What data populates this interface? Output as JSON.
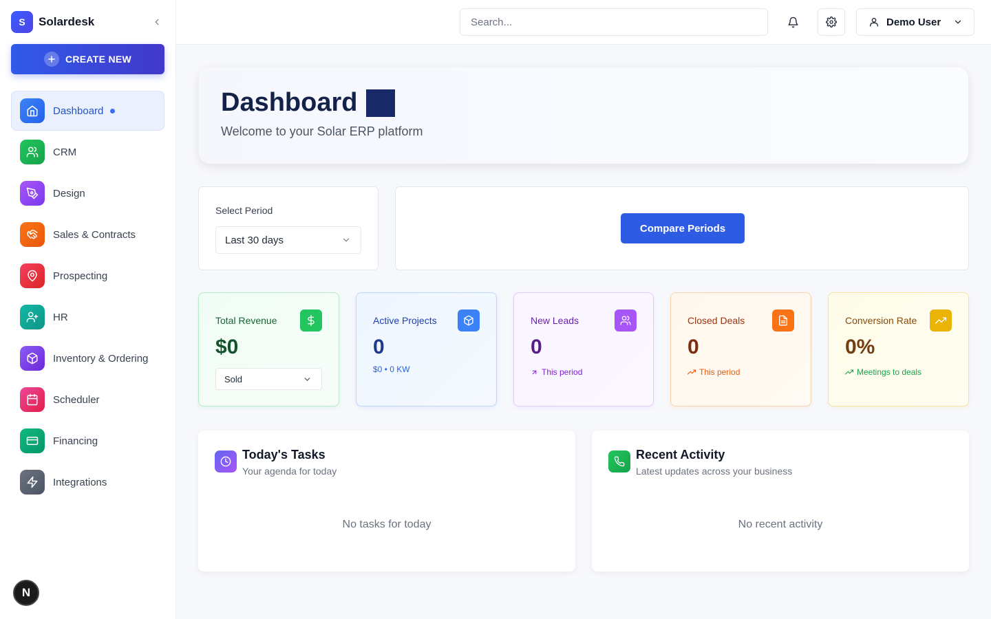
{
  "brand": {
    "name": "Solardesk",
    "logo_letter": "S"
  },
  "sidebar": {
    "create_label": "CREATE NEW",
    "items": [
      {
        "label": "Dashboard",
        "icon": "home-icon",
        "color": "#3b6ef5",
        "active": true
      },
      {
        "label": "CRM",
        "icon": "users-icon",
        "color": "#22c55e"
      },
      {
        "label": "Design",
        "icon": "pen-tool-icon",
        "color": "#a855f7"
      },
      {
        "label": "Sales & Contracts",
        "icon": "handshake-icon",
        "color": "#f97316"
      },
      {
        "label": "Prospecting",
        "icon": "map-pin-icon",
        "color": "#ef4444"
      },
      {
        "label": "HR",
        "icon": "user-plus-icon",
        "color": "#14b8a6"
      },
      {
        "label": "Inventory & Ordering",
        "icon": "package-icon",
        "color": "#8b5cf6"
      },
      {
        "label": "Scheduler",
        "icon": "calendar-icon",
        "color": "#ec4899"
      },
      {
        "label": "Financing",
        "icon": "credit-card-icon",
        "color": "#10b981"
      },
      {
        "label": "Integrations",
        "icon": "zap-icon",
        "color": "#6b7280"
      }
    ],
    "footer_badge": "N"
  },
  "topbar": {
    "search_placeholder": "Search...",
    "user_name": "Demo User"
  },
  "hero": {
    "title": "Dashboard",
    "subtitle": "Welcome to your Solar ERP platform"
  },
  "period": {
    "label": "Select Period",
    "selected": "Last 30 days",
    "compare_label": "Compare Periods"
  },
  "stats": [
    {
      "title": "Total Revenue",
      "value": "$0",
      "select_value": "Sold",
      "icon": "dollar-icon",
      "accent": "#22c55e"
    },
    {
      "title": "Active Projects",
      "value": "0",
      "sub": "$0 • 0 KW",
      "icon": "package-icon",
      "accent": "#3b82f6"
    },
    {
      "title": "New Leads",
      "value": "0",
      "sub": "This period",
      "icon": "users-icon",
      "accent": "#a855f7"
    },
    {
      "title": "Closed Deals",
      "value": "0",
      "sub": "This period",
      "icon": "file-text-icon",
      "accent": "#f97316"
    },
    {
      "title": "Conversion Rate",
      "value": "0%",
      "sub": "Meetings to deals",
      "icon": "trending-up-icon",
      "accent": "#eab308"
    }
  ],
  "tasks": {
    "title": "Today's Tasks",
    "subtitle": "Your agenda for today",
    "empty": "No tasks for today"
  },
  "activity": {
    "title": "Recent Activity",
    "subtitle": "Latest updates across your business",
    "empty": "No recent activity"
  }
}
